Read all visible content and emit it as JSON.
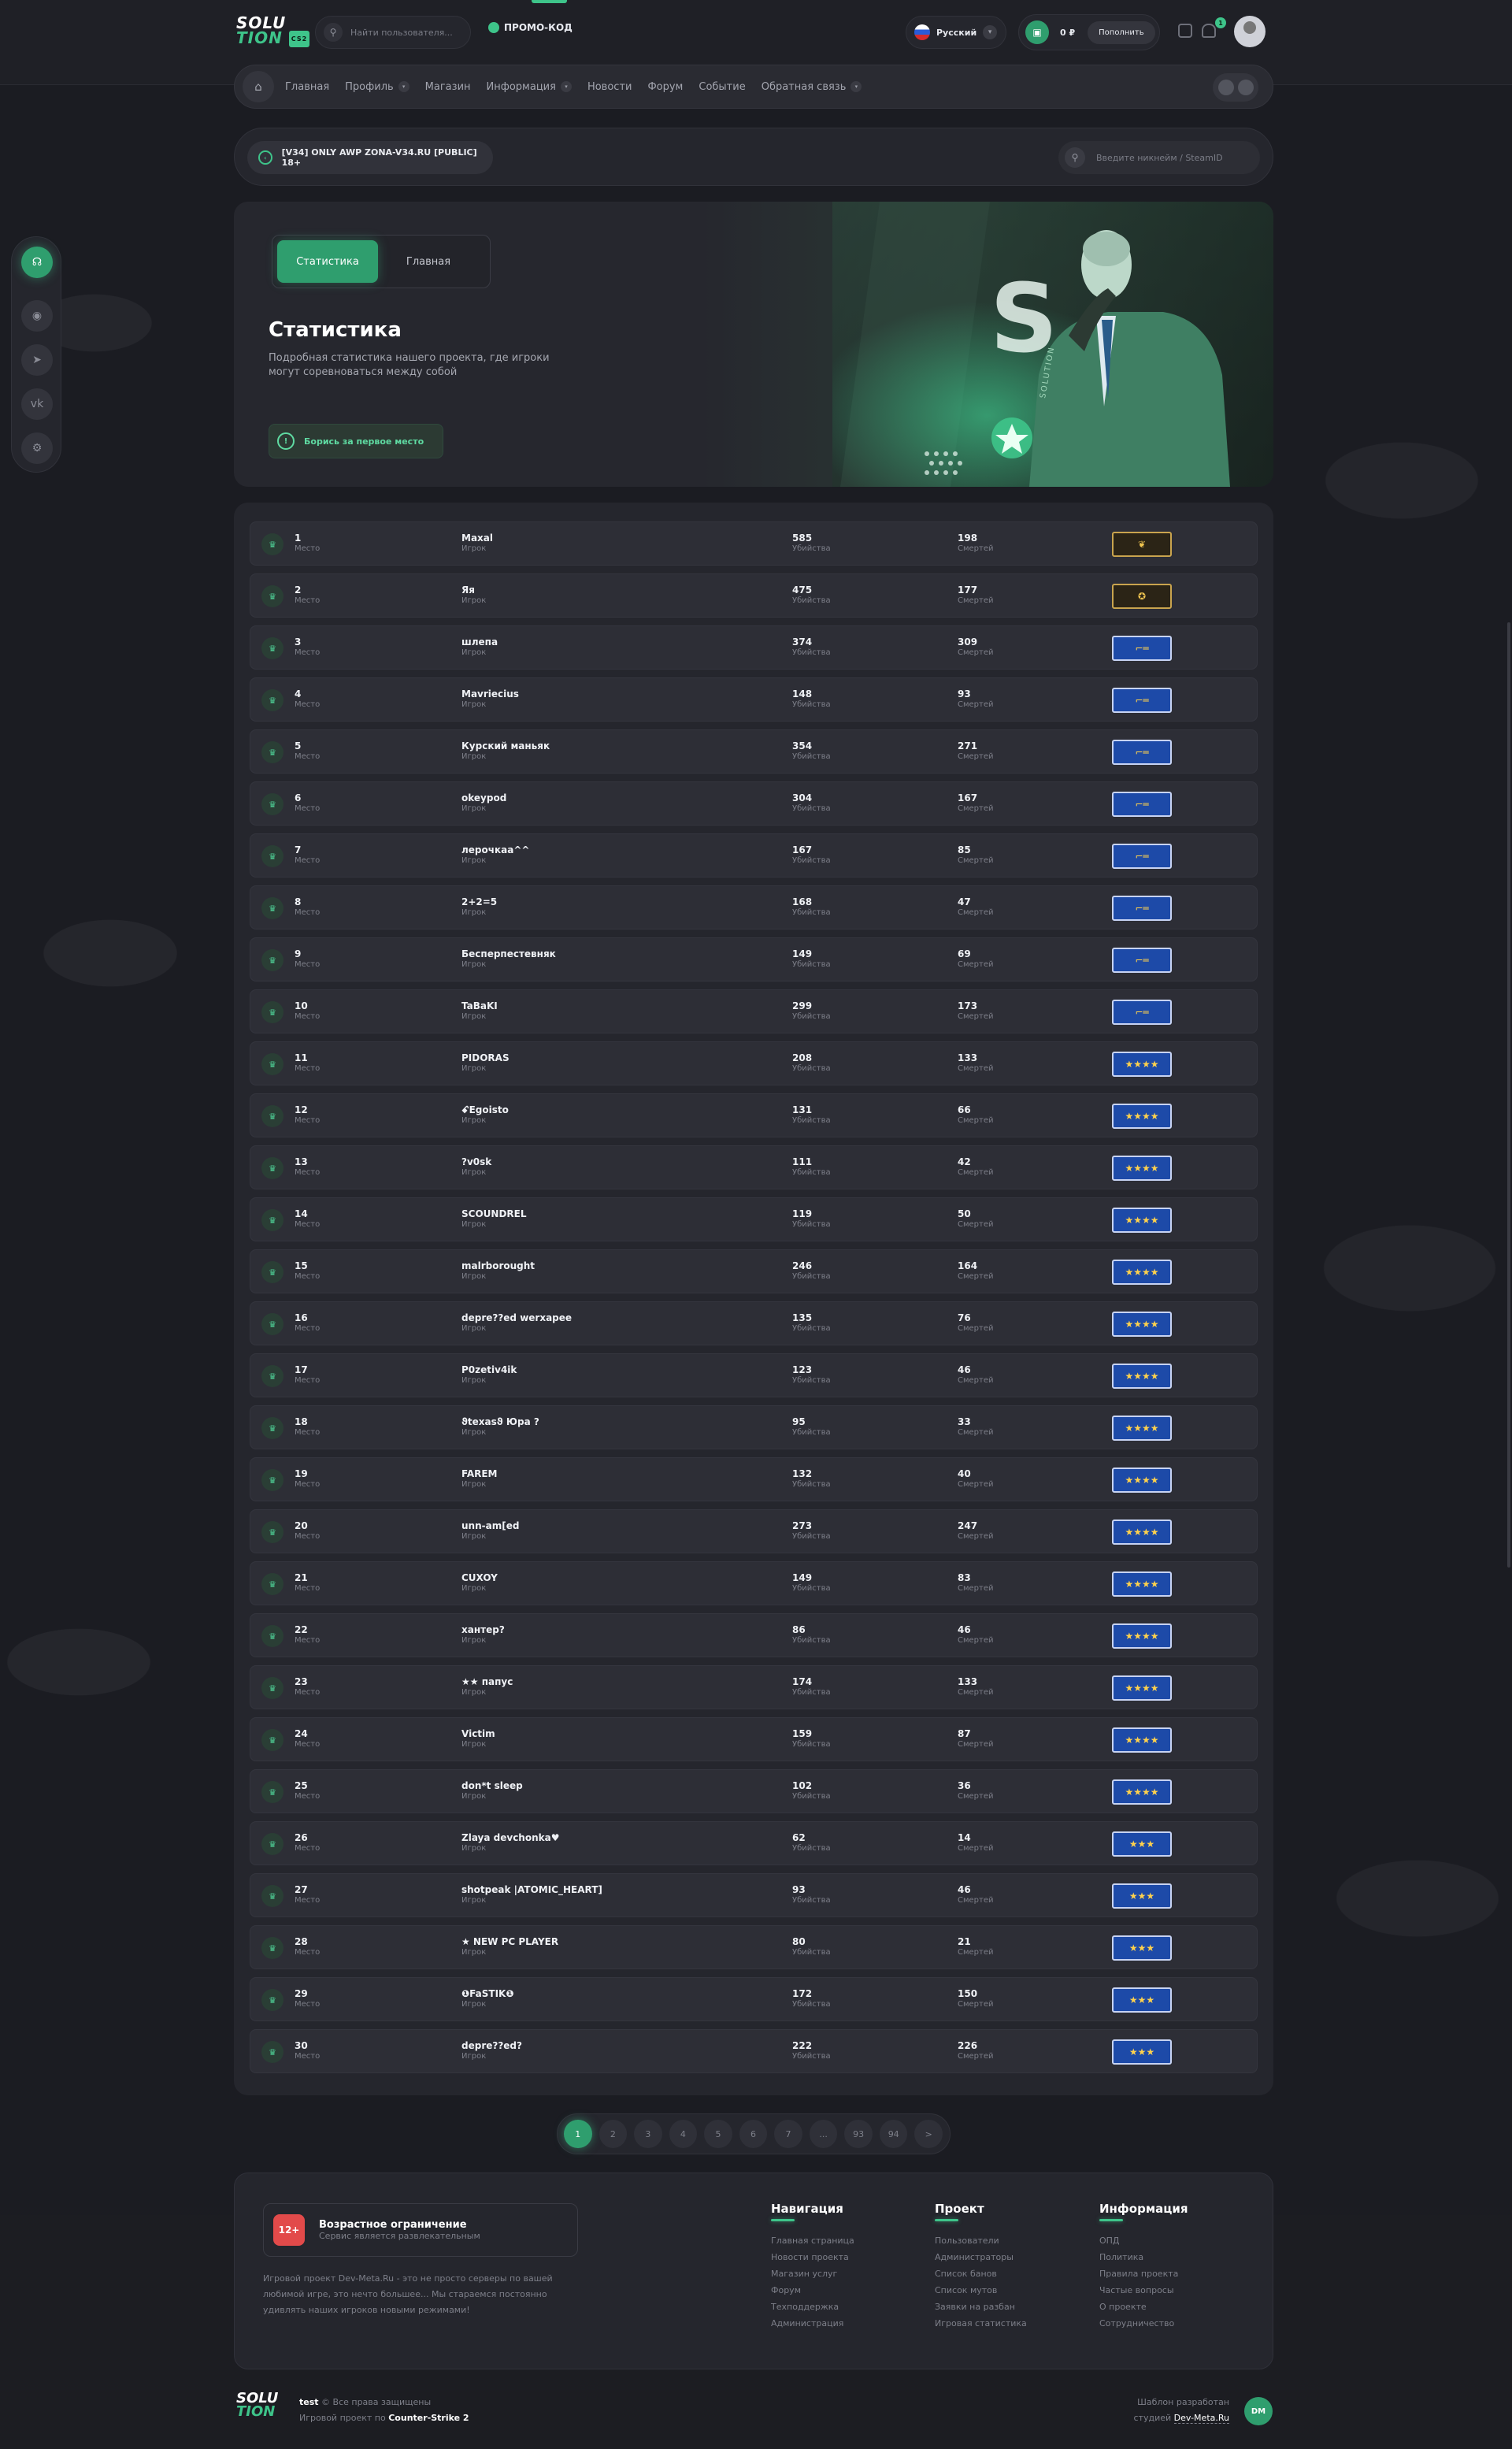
{
  "header": {
    "search_placeholder": "Найти пользователя...",
    "promo_label": "ПРОМО-КОД",
    "language": "Русский",
    "balance": "0 ₽",
    "topup_label": "Пополнить",
    "notification_count": "1"
  },
  "nav": {
    "items": [
      "Главная",
      "Профиль",
      "Магазин",
      "Информация",
      "Новости",
      "Форум",
      "Событие",
      "Обратная связь"
    ]
  },
  "server": {
    "name": "[V34] ONLY AWP ZONA-V34.RU [PUBLIC] 18+",
    "search_placeholder": "Введите никнейм / SteamID"
  },
  "hero": {
    "tab_stats": "Статистика",
    "tab_main": "Главная",
    "title": "Статистика",
    "description": "Подробная статистика нашего проекта, где игроки могут соревноваться между собой",
    "cta": "Борись за первое место"
  },
  "labels": {
    "place": "Место",
    "player": "Игрок",
    "kills": "Убийства",
    "deaths": "Смертей"
  },
  "players": [
    {
      "place": "1",
      "name": "Maxal",
      "kills": "585",
      "deaths": "198",
      "rank": "gold-eagle"
    },
    {
      "place": "2",
      "name": "Яя",
      "kills": "475",
      "deaths": "177",
      "rank": "gold-star"
    },
    {
      "place": "3",
      "name": "шлепа",
      "kills": "374",
      "deaths": "309",
      "rank": "blue-ak"
    },
    {
      "place": "4",
      "name": "Mavriecius",
      "kills": "148",
      "deaths": "93",
      "rank": "blue-ak"
    },
    {
      "place": "5",
      "name": "Курский маньяк",
      "kills": "354",
      "deaths": "271",
      "rank": "blue-ak"
    },
    {
      "place": "6",
      "name": "okeypod",
      "kills": "304",
      "deaths": "167",
      "rank": "blue-ak"
    },
    {
      "place": "7",
      "name": "лерочкаа^^",
      "kills": "167",
      "deaths": "85",
      "rank": "blue-ak"
    },
    {
      "place": "8",
      "name": "2+2=5",
      "kills": "168",
      "deaths": "47",
      "rank": "blue-ak"
    },
    {
      "place": "9",
      "name": "Бесперпестевняк",
      "kills": "149",
      "deaths": "69",
      "rank": "blue-ak"
    },
    {
      "place": "10",
      "name": "TaBaKI",
      "kills": "299",
      "deaths": "173",
      "rank": "blue-ak"
    },
    {
      "place": "11",
      "name": "PIDORAS",
      "kills": "208",
      "deaths": "133",
      "rank": "blue-stars"
    },
    {
      "place": "12",
      "name": "ꗃEgoisto",
      "kills": "131",
      "deaths": "66",
      "rank": "blue-stars"
    },
    {
      "place": "13",
      "name": "?v0sk",
      "kills": "111",
      "deaths": "42",
      "rank": "blue-stars"
    },
    {
      "place": "14",
      "name": "SCOUNDREL",
      "kills": "119",
      "deaths": "50",
      "rank": "blue-stars"
    },
    {
      "place": "15",
      "name": "malrborought",
      "kills": "246",
      "deaths": "164",
      "rank": "blue-stars"
    },
    {
      "place": "16",
      "name": "depre??ed werxapee",
      "kills": "135",
      "deaths": "76",
      "rank": "blue-stars"
    },
    {
      "place": "17",
      "name": "P0zetiv4ik",
      "kills": "123",
      "deaths": "46",
      "rank": "blue-stars"
    },
    {
      "place": "18",
      "name": "ϑtexasϑ Юра ?",
      "kills": "95",
      "deaths": "33",
      "rank": "blue-stars"
    },
    {
      "place": "19",
      "name": "FAREM",
      "kills": "132",
      "deaths": "40",
      "rank": "blue-stars"
    },
    {
      "place": "20",
      "name": "unn-am[ed",
      "kills": "273",
      "deaths": "247",
      "rank": "blue-stars"
    },
    {
      "place": "21",
      "name": "CUXOY",
      "kills": "149",
      "deaths": "83",
      "rank": "blue-stars"
    },
    {
      "place": "22",
      "name": "хантер?",
      "kills": "86",
      "deaths": "46",
      "rank": "blue-stars"
    },
    {
      "place": "23",
      "name": "★★ папус",
      "kills": "174",
      "deaths": "133",
      "rank": "blue-stars"
    },
    {
      "place": "24",
      "name": "Victim",
      "kills": "159",
      "deaths": "87",
      "rank": "blue-stars"
    },
    {
      "place": "25",
      "name": "don*t sleep",
      "kills": "102",
      "deaths": "36",
      "rank": "blue-stars"
    },
    {
      "place": "26",
      "name": "Zlaya devchonka♥",
      "kills": "62",
      "deaths": "14",
      "rank": "blue-stars3"
    },
    {
      "place": "27",
      "name": "shotpeak |ATOMIC_HEART]",
      "kills": "93",
      "deaths": "46",
      "rank": "blue-stars3"
    },
    {
      "place": "28",
      "name": "★ NEW PC PLAYER",
      "kills": "80",
      "deaths": "21",
      "rank": "blue-stars3"
    },
    {
      "place": "29",
      "name": "❶FaSTIK❶",
      "kills": "172",
      "deaths": "150",
      "rank": "blue-stars3"
    },
    {
      "place": "30",
      "name": "depre??ed?",
      "kills": "222",
      "deaths": "226",
      "rank": "blue-stars3"
    }
  ],
  "pagination": [
    "1",
    "2",
    "3",
    "4",
    "5",
    "6",
    "7",
    "...",
    "93",
    "94",
    ">"
  ],
  "footer": {
    "age_badge": "12+",
    "age_title": "Возрастное ограничение",
    "age_sub": "Сервис является развлекательным",
    "description": "Игровой проект Dev-Meta.Ru - это не просто серверы по вашей любимой игре, это нечто большее... Мы стараемся постоянно удивлять наших игроков новыми режимами!",
    "cols": [
      {
        "title": "Навигация",
        "links": [
          "Главная страница",
          "Новости проекта",
          "Магазин услуг",
          "Форум",
          "Техподдержка",
          "Администрация"
        ]
      },
      {
        "title": "Проект",
        "links": [
          "Пользователи",
          "Администраторы",
          "Список банов",
          "Список мутов",
          "Заявки на разбан",
          "Игровая статистика"
        ]
      },
      {
        "title": "Информация",
        "links": [
          "ОПД",
          "Политика",
          "Правила проекта",
          "Частые вопросы",
          "О проекте",
          "Сотрудничество"
        ]
      }
    ],
    "copyright_name": "test",
    "copyright_text": "© Все права защищены",
    "project_line": "Игровой проект по",
    "game": "Counter-Strike 2",
    "made_by_line1": "Шаблон разработан",
    "made_by_line2": "студией",
    "studio": "Dev-Meta.Ru",
    "studio_badge": "DM"
  },
  "colors": {
    "accent": "#3ec48a",
    "background": "#1b1c22",
    "panel": "#25262d",
    "row": "#2d2e36"
  }
}
